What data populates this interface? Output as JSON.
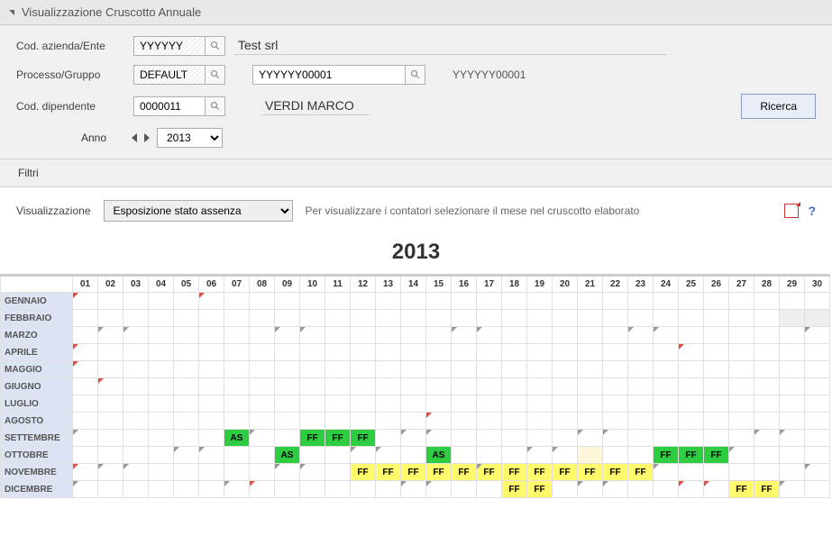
{
  "header": {
    "title": "Visualizzazione Cruscotto Annuale"
  },
  "form": {
    "codAziendaLabel": "Cod. azienda/Ente",
    "codAziendaValue": "YYYYYY",
    "aziendaName": "Test srl",
    "processoLabel": "Processo/Gruppo",
    "processoValue": "DEFAULT",
    "processoCode": "YYYYYY00001",
    "processoCode2": "YYYYYY00001",
    "codDipLabel": "Cod. dipendente",
    "codDipValue": "0000011",
    "dipName": "VERDI MARCO",
    "searchBtn": "Ricerca",
    "annoLabel": "Anno",
    "annoValue": "2013"
  },
  "filters": {
    "title": "Filtri"
  },
  "vis": {
    "label": "Visualizzazione",
    "selectValue": "Esposizione stato assenza",
    "hint": "Per visualizzare i contatori selezionare il mese nel cruscotto elaborato"
  },
  "yearTitle": "2013",
  "days": [
    "01",
    "02",
    "03",
    "04",
    "05",
    "06",
    "07",
    "08",
    "09",
    "10",
    "11",
    "12",
    "13",
    "14",
    "15",
    "16",
    "17",
    "18",
    "19",
    "20",
    "21",
    "22",
    "23",
    "24",
    "25",
    "26",
    "27",
    "28",
    "29",
    "30"
  ],
  "months": [
    {
      "name": "GENNAIO",
      "cells": [
        {
          "d": 1,
          "m": "r"
        },
        {
          "d": 6,
          "m": "r"
        }
      ]
    },
    {
      "name": "FEBBRAIO",
      "cells": [
        {
          "d": 29,
          "c": "grey"
        },
        {
          "d": 30,
          "c": "grey"
        }
      ]
    },
    {
      "name": "MARZO",
      "cells": [
        {
          "d": 2,
          "m": "g"
        },
        {
          "d": 3,
          "m": "g"
        },
        {
          "d": 9,
          "m": "g"
        },
        {
          "d": 10,
          "m": "g"
        },
        {
          "d": 16,
          "m": "g"
        },
        {
          "d": 17,
          "m": "g"
        },
        {
          "d": 23,
          "m": "g"
        },
        {
          "d": 24,
          "m": "g"
        },
        {
          "d": 30,
          "m": "g"
        }
      ]
    },
    {
      "name": "APRILE",
      "cells": [
        {
          "d": 1,
          "m": "r"
        },
        {
          "d": 25,
          "m": "r"
        }
      ]
    },
    {
      "name": "MAGGIO",
      "cells": [
        {
          "d": 1,
          "m": "r"
        }
      ]
    },
    {
      "name": "GIUGNO",
      "cells": [
        {
          "d": 2,
          "m": "r"
        }
      ]
    },
    {
      "name": "LUGLIO",
      "cells": []
    },
    {
      "name": "AGOSTO",
      "cells": [
        {
          "d": 15,
          "m": "r"
        }
      ]
    },
    {
      "name": "SETTEMBRE",
      "cells": [
        {
          "d": 1,
          "m": "g"
        },
        {
          "d": 7,
          "t": "AS",
          "c": "as-green"
        },
        {
          "d": 8,
          "m": "g"
        },
        {
          "d": 10,
          "t": "FF",
          "c": "ff-green"
        },
        {
          "d": 11,
          "t": "FF",
          "c": "ff-green"
        },
        {
          "d": 12,
          "t": "FF",
          "c": "ff-green"
        },
        {
          "d": 14,
          "m": "g"
        },
        {
          "d": 15,
          "m": "g"
        },
        {
          "d": 21,
          "m": "g"
        },
        {
          "d": 22,
          "m": "g"
        },
        {
          "d": 28,
          "m": "g"
        },
        {
          "d": 29,
          "m": "g"
        }
      ]
    },
    {
      "name": "OTTOBRE",
      "cells": [
        {
          "d": 5,
          "m": "g"
        },
        {
          "d": 6,
          "m": "g"
        },
        {
          "d": 9,
          "t": "AS",
          "c": "as-green"
        },
        {
          "d": 12,
          "m": "g"
        },
        {
          "d": 13,
          "m": "g"
        },
        {
          "d": 15,
          "t": "AS",
          "c": "as-green"
        },
        {
          "d": 19,
          "m": "g"
        },
        {
          "d": 20,
          "m": "g"
        },
        {
          "d": 21,
          "c": "cream"
        },
        {
          "d": 24,
          "t": "FF",
          "c": "ff-green"
        },
        {
          "d": 25,
          "t": "FF",
          "c": "ff-green"
        },
        {
          "d": 26,
          "t": "FF",
          "c": "ff-green"
        },
        {
          "d": 27,
          "m": "g"
        }
      ]
    },
    {
      "name": "NOVEMBRE",
      "cells": [
        {
          "d": 1,
          "m": "r"
        },
        {
          "d": 2,
          "m": "g"
        },
        {
          "d": 3,
          "m": "g"
        },
        {
          "d": 9,
          "m": "g"
        },
        {
          "d": 10,
          "m": "g"
        },
        {
          "d": 12,
          "t": "FF",
          "c": "ff-yellow"
        },
        {
          "d": 13,
          "t": "FF",
          "c": "ff-yellow"
        },
        {
          "d": 14,
          "t": "FF",
          "c": "ff-yellow"
        },
        {
          "d": 15,
          "t": "FF",
          "c": "ff-yellow"
        },
        {
          "d": 16,
          "t": "FF",
          "c": "ff-yellow"
        },
        {
          "d": 17,
          "t": "FF",
          "c": "ff-yellow",
          "m": "g"
        },
        {
          "d": 18,
          "t": "FF",
          "c": "ff-yellow"
        },
        {
          "d": 19,
          "t": "FF",
          "c": "ff-yellow"
        },
        {
          "d": 20,
          "t": "FF",
          "c": "ff-yellow"
        },
        {
          "d": 21,
          "t": "FF",
          "c": "ff-yellow"
        },
        {
          "d": 22,
          "t": "FF",
          "c": "ff-yellow"
        },
        {
          "d": 23,
          "t": "FF",
          "c": "ff-yellow"
        },
        {
          "d": 24,
          "m": "g"
        },
        {
          "d": 30,
          "m": "g"
        }
      ]
    },
    {
      "name": "DICEMBRE",
      "cells": [
        {
          "d": 1,
          "m": "g"
        },
        {
          "d": 7,
          "m": "g"
        },
        {
          "d": 8,
          "m": "r"
        },
        {
          "d": 14,
          "m": "g"
        },
        {
          "d": 15,
          "m": "g"
        },
        {
          "d": 18,
          "t": "FF",
          "c": "ff-yellow"
        },
        {
          "d": 19,
          "t": "FF",
          "c": "ff-yellow"
        },
        {
          "d": 21,
          "m": "g"
        },
        {
          "d": 22,
          "m": "g"
        },
        {
          "d": 25,
          "m": "r"
        },
        {
          "d": 26,
          "m": "r"
        },
        {
          "d": 27,
          "t": "FF",
          "c": "ff-yellow"
        },
        {
          "d": 28,
          "t": "FF",
          "c": "ff-yellow"
        },
        {
          "d": 29,
          "m": "g"
        }
      ]
    }
  ]
}
